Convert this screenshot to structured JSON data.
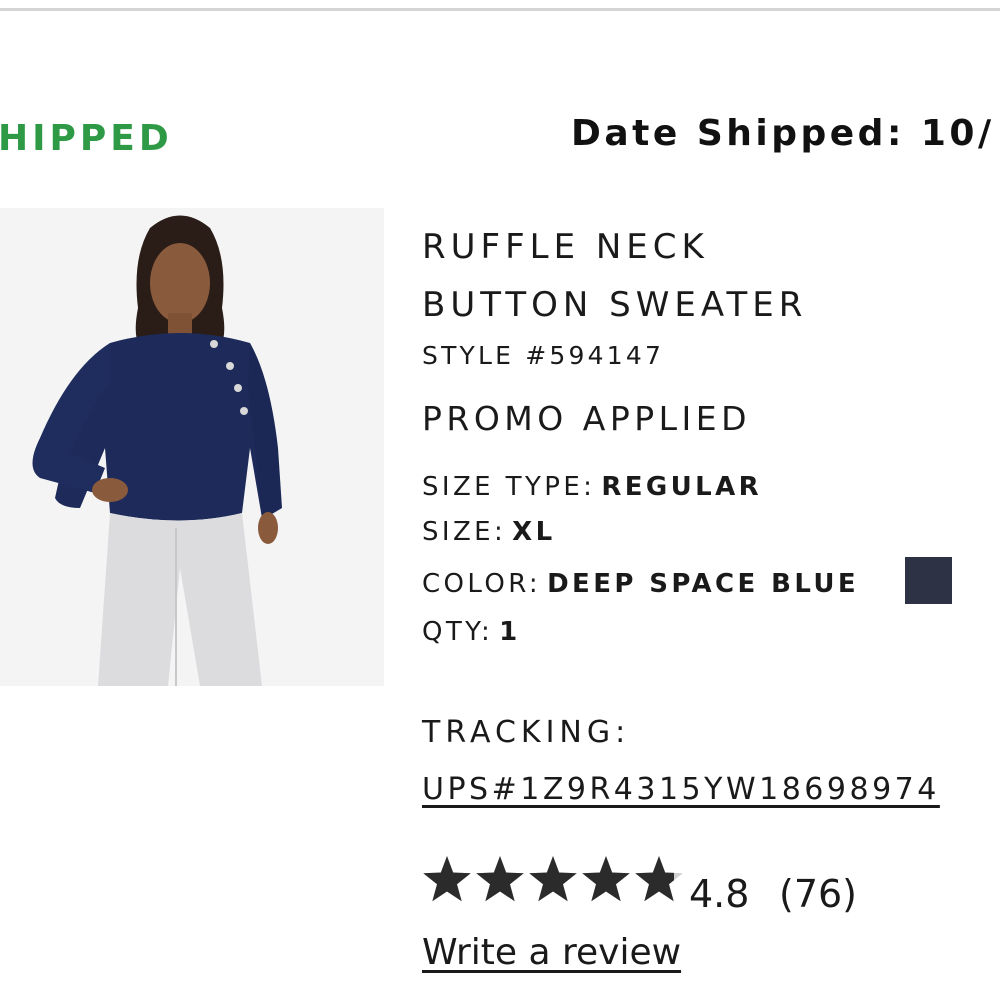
{
  "shipment": {
    "status_label": "HIPPED",
    "status_color": "#2e9a46",
    "date_shipped_label": "Date Shipped: 10/"
  },
  "product": {
    "name_line1": "RUFFLE NECK",
    "name_line2": "BUTTON SWEATER",
    "style": "STYLE #594147",
    "promo": "PROMO APPLIED",
    "image_alt": "Model wearing navy ruffle neck button sweater with white jeans",
    "attributes": {
      "size_type_label": "SIZE TYPE:",
      "size_type_value": "REGULAR",
      "size_label": "SIZE:",
      "size_value": "XL",
      "color_label": "COLOR:",
      "color_value": "DEEP SPACE BLUE",
      "color_swatch": "#2d3345",
      "qty_label": "QTY:",
      "qty_value": "1"
    }
  },
  "tracking": {
    "label": "TRACKING:",
    "number": "UPS#1Z9R4315YW18698974"
  },
  "review": {
    "rating_value": "4.8",
    "rating_fraction": 0.96,
    "count": "(76)",
    "write_review_label": "Write a review",
    "star_icon": "star-icon"
  }
}
